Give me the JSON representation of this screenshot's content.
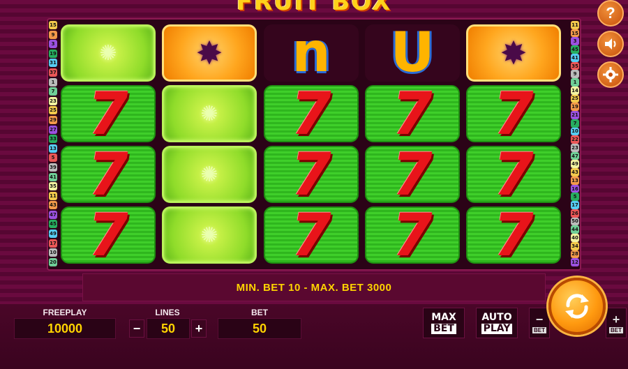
{
  "game": {
    "title": "FRUIT BOX"
  },
  "reels": [
    [
      "lime",
      "seven",
      "seven",
      "seven"
    ],
    [
      "orange",
      "lime",
      "lime",
      "lime"
    ],
    [
      "letter-n",
      "seven",
      "seven",
      "seven"
    ],
    [
      "letter-u",
      "seven",
      "seven",
      "seven"
    ],
    [
      "orange",
      "seven",
      "seven",
      "seven"
    ]
  ],
  "symbols": {
    "seven": "7",
    "letter_n": "n",
    "letter_u": "U"
  },
  "paylines": {
    "left": [
      "15",
      "9",
      "3",
      "19",
      "31",
      "37",
      "1",
      "7",
      "23",
      "25",
      "29",
      "27",
      "33",
      "13",
      "5",
      "39",
      "41",
      "35",
      "11",
      "43",
      "47",
      "45",
      "49",
      "17",
      "10",
      "20"
    ],
    "right": [
      "11",
      "15",
      "3",
      "45",
      "41",
      "35",
      "9",
      "1",
      "14",
      "25",
      "19",
      "21",
      "7",
      "10",
      "22",
      "23",
      "47",
      "49",
      "43",
      "13",
      "16",
      "5",
      "17",
      "26",
      "50",
      "44",
      "40",
      "34",
      "28",
      "12"
    ],
    "colors": [
      "#f2c94c",
      "#f2994a",
      "#9b51e0",
      "#27ae60",
      "#56ccf2",
      "#eb5757",
      "#bbbbbb",
      "#6fcf97",
      "#f2f2a0"
    ]
  },
  "message": "MIN. BET 10 - MAX. BET 3000",
  "freeplay": {
    "label": "FREEPLAY",
    "value": "10000"
  },
  "lines": {
    "label": "LINES",
    "value": "50",
    "minus": "−",
    "plus": "+"
  },
  "bet": {
    "label": "BET",
    "value": "50"
  },
  "buttons": {
    "max_bet_top": "MAX",
    "max_bet_bottom": "BET",
    "auto_play_top": "AUTO",
    "auto_play_bottom": "PLAY",
    "bet_minus": "−",
    "bet_minus_sub": "BET",
    "bet_plus": "+",
    "bet_plus_sub": "BET",
    "help": "?"
  },
  "colors": {
    "accent": "#ffd400",
    "background": "#6a0a3f",
    "spin": "#ff9a10"
  }
}
